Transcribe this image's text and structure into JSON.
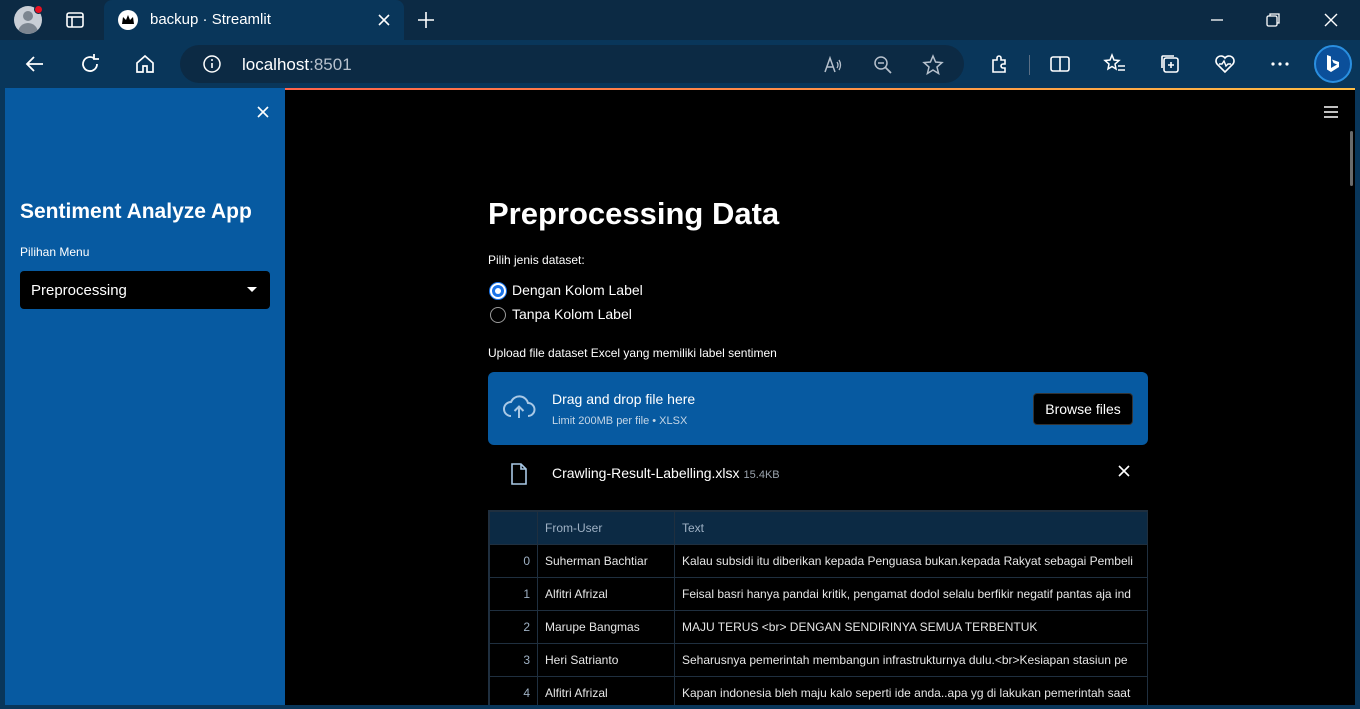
{
  "browser": {
    "tab_title": "backup · Streamlit",
    "address_host": "localhost",
    "address_port": ":8501"
  },
  "sidebar": {
    "title": "Sentiment Analyze App",
    "menu_label": "Pilihan Menu",
    "menu_selected": "Preprocessing"
  },
  "main": {
    "title": "Preprocessing Data",
    "dataset_label": "Pilih jenis dataset:",
    "radio_options": [
      "Dengan Kolom Label",
      "Tanpa Kolom Label"
    ],
    "selected_option": "Dengan Kolom Label",
    "upload_label": "Upload file dataset Excel yang memiliki label sentimen",
    "dropzone_title": "Drag and drop file here",
    "dropzone_limit": "Limit 200MB per file • XLSX",
    "browse_label": "Browse files",
    "file_name": "Crawling-Result-Labelling.xlsx",
    "file_size": "15.4KB"
  },
  "table": {
    "columns": [
      "",
      "From-User",
      "Text"
    ],
    "rows": [
      [
        "0",
        "Suherman Bachtiar",
        "Kalau subsidi itu diberikan kepada Penguasa bukan.kepada Rakyat sebagai Pembeli"
      ],
      [
        "1",
        "Alfitri Afrizal",
        "Feisal basri hanya pandai kritik, pengamat dodol selalu berfikir negatif pantas aja ind"
      ],
      [
        "2",
        "Marupe Bangmas",
        "MAJU TERUS <br> DENGAN SENDIRINYA  SEMUA TERBENTUK"
      ],
      [
        "3",
        "Heri Satrianto",
        "Seharusnya pemerintah membangun infrastrukturnya dulu.<br>Kesiapan stasiun pe"
      ],
      [
        "4",
        "Alfitri Afrizal",
        "Kapan indonesia bleh maju kalo seperti ide anda..apa yg di lakukan pemerintah saat"
      ]
    ]
  },
  "colors": {
    "sidebar_bg": "#075aa1",
    "dropzone_bg": "#075aa1",
    "radio_accent": "#1a73e8",
    "browser_chrome": "#09365a"
  }
}
